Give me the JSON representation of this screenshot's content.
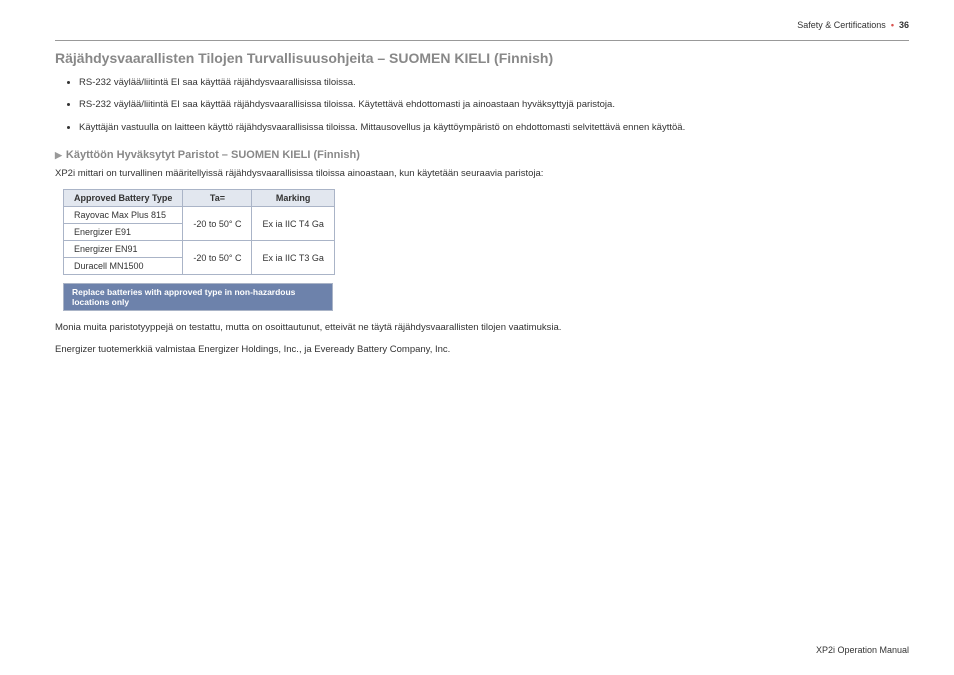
{
  "header": {
    "section": "Safety & Certifications",
    "page": "36"
  },
  "title": "Räjähdysvaarallisten Tilojen Turvallisuusohjeita – SUOMEN KIELI (Finnish)",
  "bullets": [
    "RS-232 väylää/liitintä EI saa käyttää räjähdysvaarallisissa tiloissa.",
    "RS-232 väylää/liitintä EI saa käyttää räjähdysvaarallisissa tiloissa. Käytettävä ehdottomasti ja ainoastaan hyväksyttyjä paristoja.",
    "Käyttäjän vastuulla on laitteen käyttö räjähdysvaarallisissa tiloissa. Mittausovellus ja käyttöympäristö on ehdottomasti selvitettävä ennen käyttöä."
  ],
  "subhead": "Käyttöön Hyväksytyt Paristot – SUOMEN KIELI (Finnish)",
  "intro": "XP2i mittari on turvallinen määritellyissä räjähdysvaarallisissa tiloissa ainoastaan, kun käytetään seuraavia paristoja:",
  "table": {
    "h1": "Approved Battery Type",
    "h2": "Ta=",
    "h3": "Marking",
    "r1c1": "Rayovac Max Plus 815",
    "r2c1": "Energizer E91",
    "g1_ta": "-20 to 50° C",
    "g1_mark": "Ex ia IIC T4 Ga",
    "r3c1": "Energizer EN91",
    "r4c1": "Duracell MN1500",
    "g2_ta": "-20 to 50° C",
    "g2_mark": "Ex ia IIC T3 Ga"
  },
  "replace_note": "Replace batteries with approved type in non-hazardous locations only",
  "para1": "Monia muita paristotyyppejä on testattu, mutta on osoittautunut, etteivät ne täytä räjähdysvaarallisten tilojen vaatimuksia.",
  "para2": "Energizer tuotemerkkiä valmistaa Energizer Holdings, Inc., ja Eveready Battery Company, Inc.",
  "footer": "XP2i Operation Manual",
  "chart_data": {
    "type": "table",
    "title": "Approved Battery Type",
    "columns": [
      "Approved Battery Type",
      "Ta=",
      "Marking"
    ],
    "rows": [
      [
        "Rayovac Max Plus 815",
        "-20 to 50° C",
        "Ex ia IIC T4 Ga"
      ],
      [
        "Energizer E91",
        "-20 to 50° C",
        "Ex ia IIC T4 Ga"
      ],
      [
        "Energizer EN91",
        "-20 to 50° C",
        "Ex ia IIC T3 Ga"
      ],
      [
        "Duracell MN1500",
        "-20 to 50° C",
        "Ex ia IIC T3 Ga"
      ]
    ]
  }
}
